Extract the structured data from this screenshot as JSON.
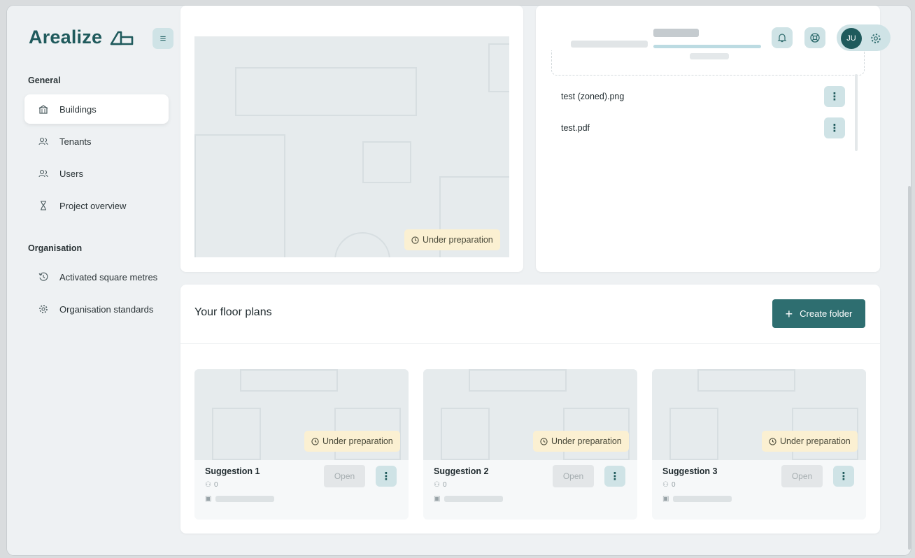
{
  "brand": {
    "name": "Arealize"
  },
  "sidebar": {
    "general_label": "General",
    "items": [
      {
        "label": "Buildings",
        "icon": "building-icon"
      },
      {
        "label": "Tenants",
        "icon": "users-icon"
      },
      {
        "label": "Users",
        "icon": "users-icon"
      },
      {
        "label": "Project overview",
        "icon": "hourglass-icon"
      }
    ],
    "organisation_label": "Organisation",
    "org_items": [
      {
        "label": "Activated square metres",
        "icon": "history-icon"
      },
      {
        "label": "Organisation standards",
        "icon": "gear-icon"
      }
    ]
  },
  "header": {
    "avatar_initials": "JU"
  },
  "plan_preview": {
    "status": "Under preparation"
  },
  "files": [
    {
      "name": "test (zoned).png"
    },
    {
      "name": "test.pdf"
    }
  ],
  "floor_plans": {
    "title": "Your floor plans",
    "create_label": "Create folder",
    "cards": [
      {
        "title": "Suggestion 1",
        "members": "0",
        "status": "Under preparation",
        "open_label": "Open"
      },
      {
        "title": "Suggestion 2",
        "members": "0",
        "status": "Under preparation",
        "open_label": "Open"
      },
      {
        "title": "Suggestion 3",
        "members": "0",
        "status": "Under preparation",
        "open_label": "Open"
      }
    ]
  },
  "colors": {
    "brand": "#1f5a5c",
    "primary_button": "#2e6e70",
    "badge_bg": "#fbf0d2",
    "icon_button_bg": "#cfe3e6"
  }
}
